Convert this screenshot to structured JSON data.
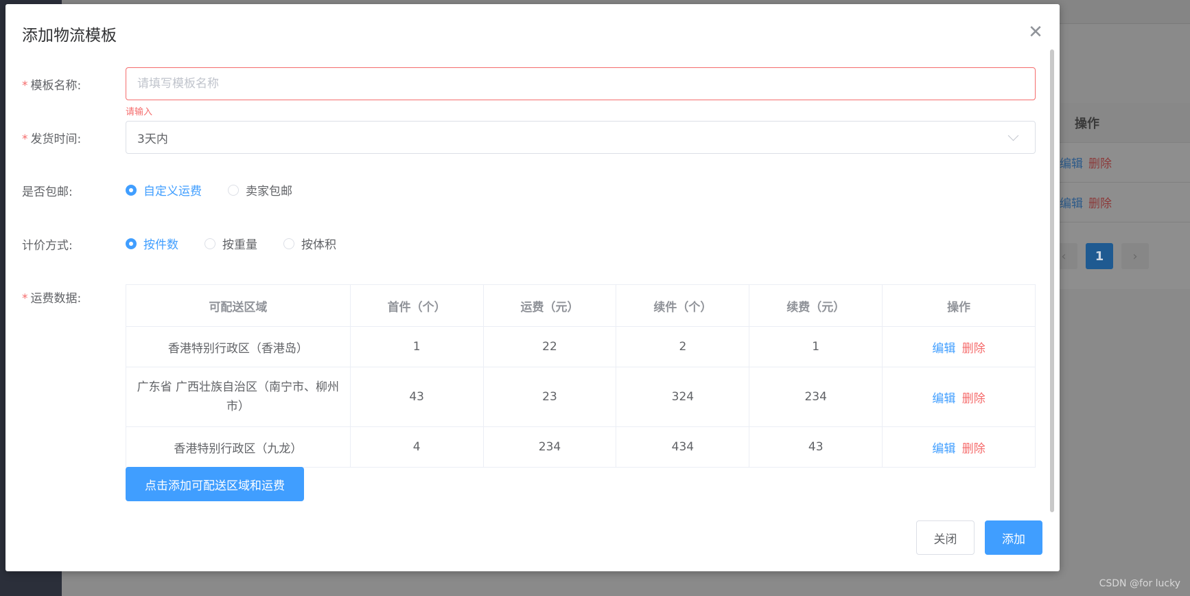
{
  "background": {
    "table_header_ops": "操作",
    "rows": [
      {
        "edit": "编辑",
        "delete": "删除"
      },
      {
        "edit": "编辑",
        "delete": "删除"
      }
    ],
    "pager": {
      "prev": "‹",
      "current": "1",
      "next": "›"
    },
    "watermark": "CSDN @for lucky"
  },
  "dialog": {
    "title": "添加物流模板",
    "close_icon": "close-icon"
  },
  "form": {
    "required_mark": "*",
    "template_name": {
      "label": "模板名称:",
      "value": "",
      "placeholder": "请填写模板名称",
      "error": "请输入"
    },
    "ship_time": {
      "label": "发货时间:",
      "selected": "3天内"
    },
    "free_shipping": {
      "label": "是否包邮:",
      "options": [
        "自定义运费",
        "卖家包邮"
      ],
      "selected_index": 0
    },
    "pricing": {
      "label": "计价方式:",
      "options": [
        "按件数",
        "按重量",
        "按体积"
      ],
      "selected_index": 0
    },
    "fee_data": {
      "label": "运费数据:"
    }
  },
  "fee_table": {
    "headers": [
      "可配送区域",
      "首件（个）",
      "运费（元）",
      "续件（个）",
      "续费（元）",
      "操作"
    ],
    "rows": [
      {
        "region": "香港特别行政区（香港岛）",
        "first": "1",
        "fee": "22",
        "extra": "2",
        "extra_fee": "1",
        "edit": "编辑",
        "delete": "删除"
      },
      {
        "region": "广东省 广西壮族自治区（南宁市、柳州市）",
        "first": "43",
        "fee": "23",
        "extra": "324",
        "extra_fee": "234",
        "edit": "编辑",
        "delete": "删除"
      },
      {
        "region": "香港特别行政区（九龙）",
        "first": "4",
        "fee": "234",
        "extra": "434",
        "extra_fee": "43",
        "edit": "编辑",
        "delete": "删除"
      }
    ]
  },
  "buttons": {
    "add_region": "点击添加可配送区域和运费",
    "close": "关闭",
    "add": "添加"
  },
  "colors": {
    "primary": "#409eff",
    "danger": "#f56c6c"
  }
}
